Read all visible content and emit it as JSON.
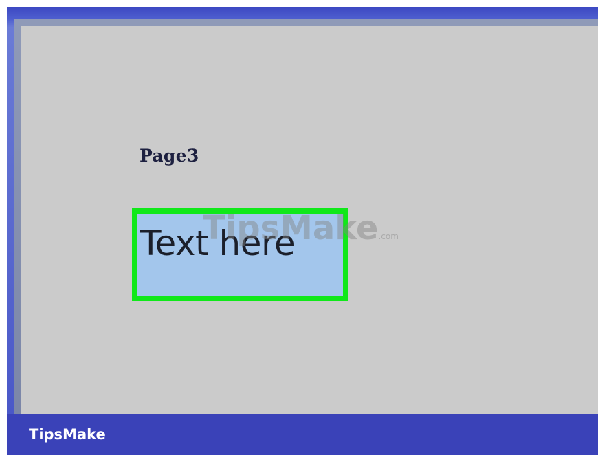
{
  "document": {
    "page_label": "Page3",
    "text_box_content": "Text here"
  },
  "watermark": {
    "main": "TipsMake",
    "suffix": ".com"
  },
  "footer": {
    "brand": "TipsMake"
  },
  "colors": {
    "frame_blue": "#3a42b8",
    "page_gray": "#cbcbcb",
    "text_box_fill": "#a3c6ec",
    "selection_border": "#10e81a"
  }
}
